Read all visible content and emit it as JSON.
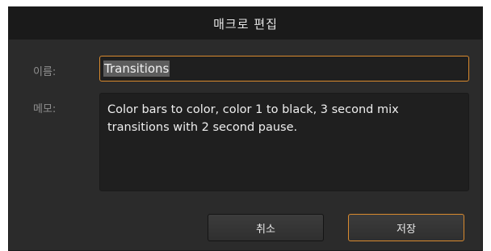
{
  "dialog": {
    "title": "매크로 편집"
  },
  "form": {
    "name_label": "이름:",
    "name_value": "Transitions",
    "memo_label": "메모:",
    "memo_value": "Color bars to color, color 1 to black, 3 second mix transitions with 2 second pause."
  },
  "buttons": {
    "cancel_label": "취소",
    "save_label": "저장"
  },
  "colors": {
    "dialog_background": "#2b2b2b",
    "titlebar_background": "#1a1a1a",
    "field_background": "#1f1f1f",
    "focus_accent": "#d98a2e"
  }
}
